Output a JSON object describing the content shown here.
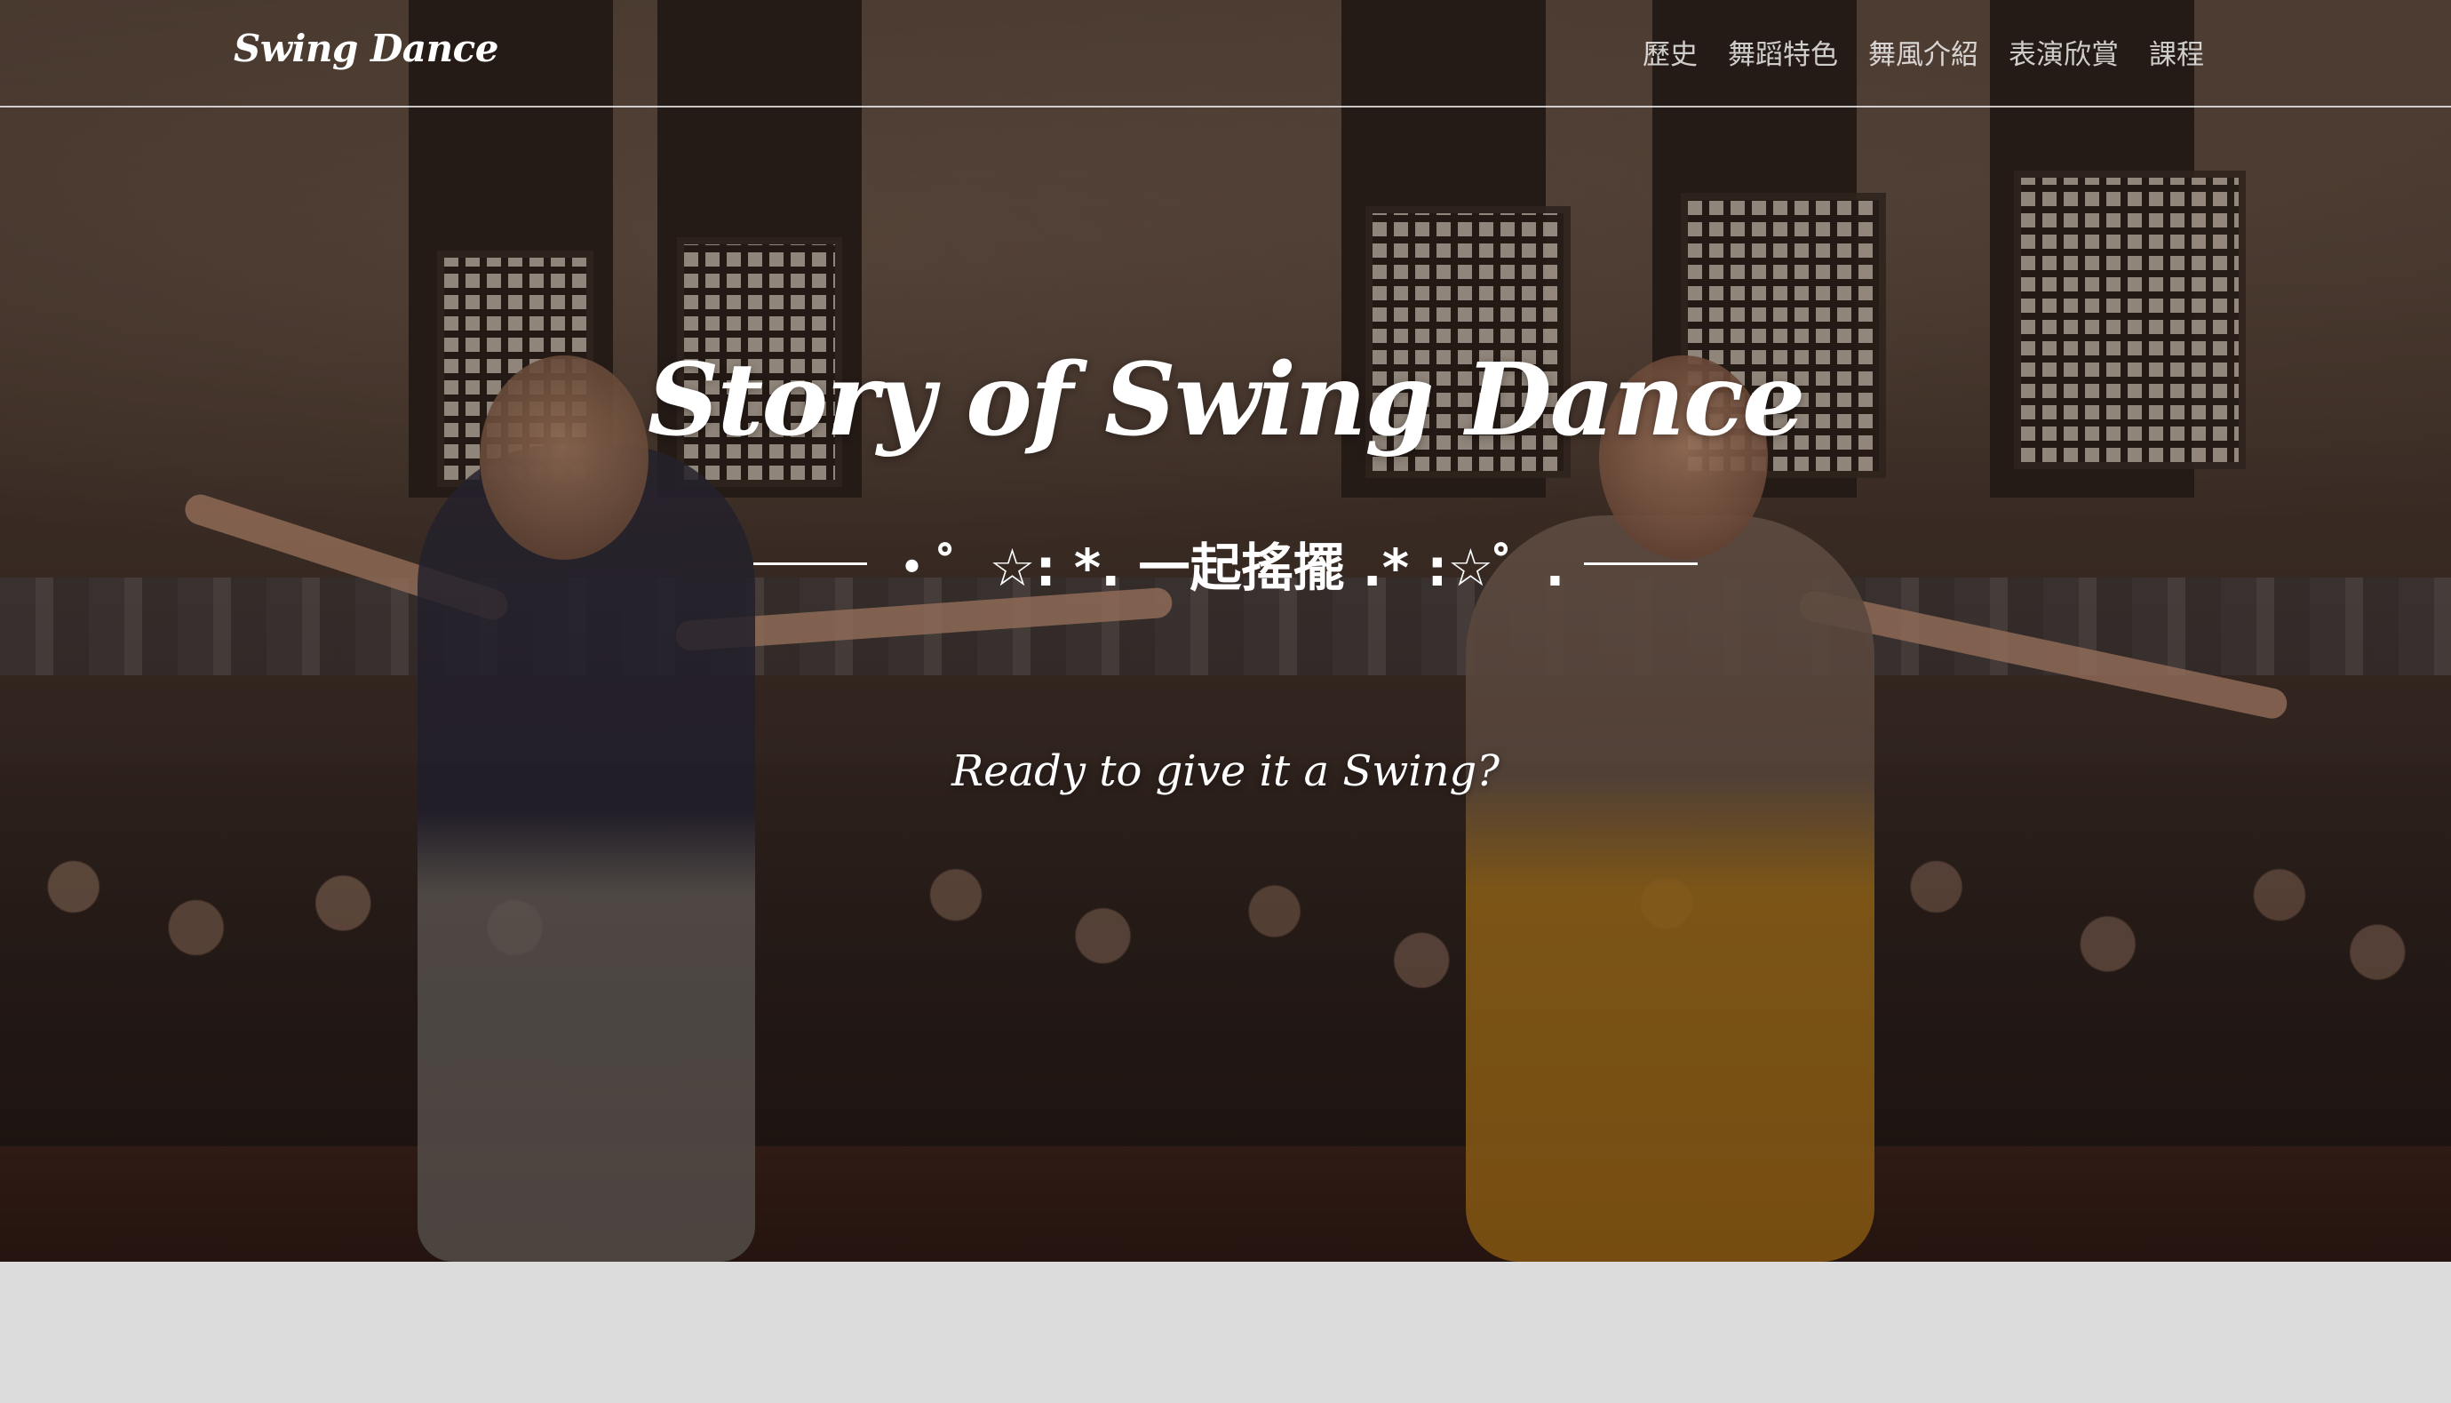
{
  "navbar": {
    "brand": "Swing Dance",
    "links": [
      "歷史",
      "舞蹈特色",
      "舞風介紹",
      "表演欣賞",
      "課程"
    ]
  },
  "hero": {
    "title": "Story of Swing Dance",
    "divider_text": "・゜☆: *. 一起搖擺 .* :☆゜.",
    "subtitle": "Ready to give it a Swing?"
  },
  "colors": {
    "hero_text": "#ffffff",
    "nav_text": "#e6e0dc",
    "below_hero_bg": "#dcdcdc"
  }
}
